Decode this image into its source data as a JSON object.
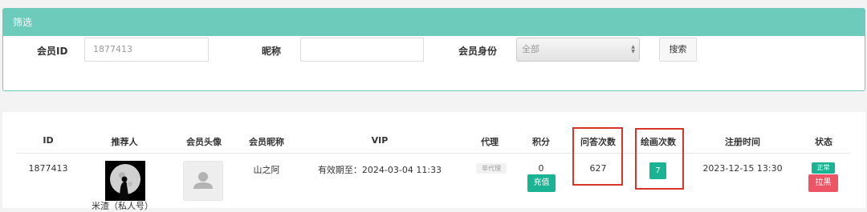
{
  "filter": {
    "title": "筛选",
    "member_id_label": "会员ID",
    "member_id_value": "1877413",
    "nickname_label": "昵称",
    "nickname_value": "",
    "identity_label": "会员身份",
    "identity_selected": "全部",
    "search_label": "搜索"
  },
  "table": {
    "headers": [
      "ID",
      "推荐人",
      "会员头像",
      "会员昵称",
      "VIP",
      "代理",
      "积分",
      "问答次数",
      "绘画次数",
      "注册时间",
      "状态"
    ],
    "row": {
      "id": "1877413",
      "referrer": "米渣（私人号）",
      "nickname": "山之阿",
      "vip": "有效期至：2024-03-04 11:33",
      "agent_tag": "非代理",
      "points": "0",
      "recharge_label": "充值",
      "qa_count": "627",
      "draw_count": "7",
      "register_time": "2023-12-15 13:30",
      "status_label": "正常",
      "ban_label": "拉黑"
    }
  },
  "icons": {
    "select_arrows": "updown-arrows-icon",
    "default_avatar": "user-silhouette-icon"
  },
  "colors": {
    "header_teal": "#6ccbbb",
    "button_teal": "#1ab394",
    "button_red": "#ed5565",
    "highlight_red": "#d9332a"
  }
}
